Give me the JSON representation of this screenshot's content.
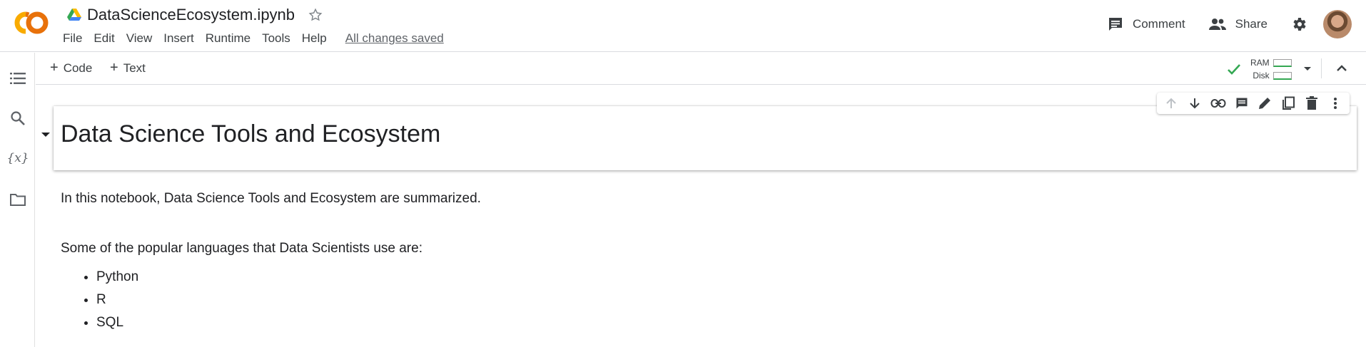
{
  "header": {
    "notebook_title": "DataScienceEcosystem.ipynb",
    "menu": [
      "File",
      "Edit",
      "View",
      "Insert",
      "Runtime",
      "Tools",
      "Help"
    ],
    "save_status": "All changes saved",
    "comment_label": "Comment",
    "share_label": "Share"
  },
  "icons": {
    "logo": "colab-logo",
    "drive": "google-drive-icon",
    "star": "star-icon",
    "comment": "comment-icon",
    "share": "people-icon",
    "settings": "gear-icon"
  },
  "rail": [
    "table-of-contents-icon",
    "search-icon",
    "variables-icon",
    "files-icon"
  ],
  "toolbar": {
    "add_code_label": "Code",
    "add_text_label": "Text",
    "ram_label": "RAM",
    "disk_label": "Disk"
  },
  "cell_toolbar": [
    "arrow-up-icon",
    "arrow-down-icon",
    "link-icon",
    "comment-icon",
    "edit-icon",
    "mirror-cell-icon",
    "delete-icon",
    "more-vert-icon"
  ],
  "notebook": {
    "heading": "Data Science Tools and Ecosystem",
    "intro": "In this notebook, Data Science Tools and Ecosystem are summarized.",
    "languages_intro": "Some of the popular languages that Data Scientists use are:",
    "languages": [
      "Python",
      "R",
      "SQL"
    ]
  },
  "colors": {
    "colab_orange": "#F9AB00",
    "colab_dark_orange": "#E8710A",
    "connected_green": "#34A853"
  }
}
